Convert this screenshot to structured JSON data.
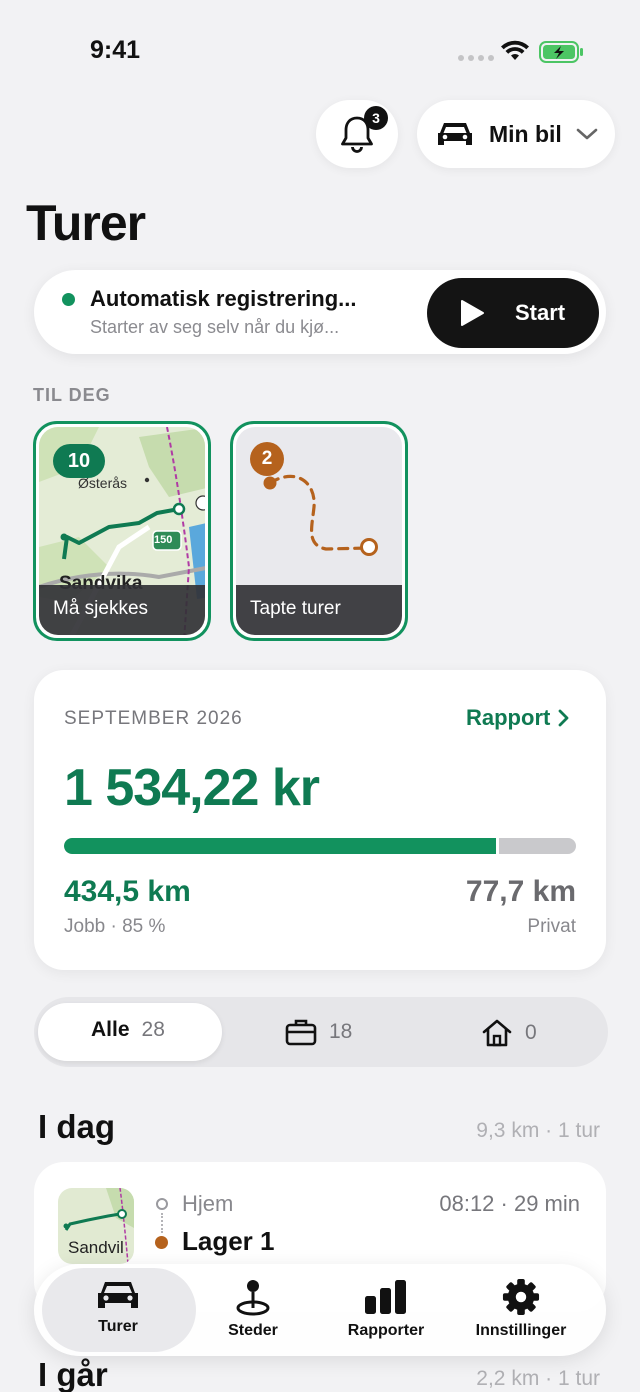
{
  "status": {
    "time": "9:41"
  },
  "header": {
    "notification_count": "3",
    "car_label": "Min bil",
    "title": "Turer"
  },
  "auto": {
    "title": "Automatisk registrering...",
    "subtitle": "Starter av seg selv når du kjø...",
    "start_label": "Start"
  },
  "for_you": {
    "label": "TIL DEG",
    "tiles": [
      {
        "badge": "10",
        "caption": "Må sjekkes",
        "map_labels": {
          "place": "Østerås",
          "city": "Sandvika",
          "road": "150"
        }
      },
      {
        "badge": "2",
        "caption": "Tapte turer"
      }
    ]
  },
  "summary": {
    "month": "SEPTEMBER 2026",
    "report_label": "Rapport",
    "amount": "1 534,22 kr",
    "job_fraction": 0.85,
    "job_km": "434,5 km",
    "job_label": "Jobb · 85 %",
    "private_km": "77,7 km",
    "private_label": "Privat"
  },
  "filters": {
    "all_label": "Alle",
    "all_count": "28",
    "work_count": "18",
    "private_count": "0"
  },
  "days": [
    {
      "title": "I dag",
      "meta": "9,3 km · 1 tur"
    },
    {
      "title": "I går",
      "meta": "2,2 km · 1 tur"
    }
  ],
  "trip": {
    "from": "Hjem",
    "to": "Lager 1",
    "time": "08:12 · 29 min",
    "thumb_label": "Sandvil"
  },
  "tabs": [
    {
      "label": "Turer",
      "icon": "car-icon"
    },
    {
      "label": "Steder",
      "icon": "map-pin-icon"
    },
    {
      "label": "Rapporter",
      "icon": "bar-chart-icon"
    },
    {
      "label": "Innstillinger",
      "icon": "gear-icon"
    }
  ],
  "colors": {
    "accent": "#0f7a52",
    "accent_bright": "#12925e",
    "missed": "#b5621d"
  }
}
